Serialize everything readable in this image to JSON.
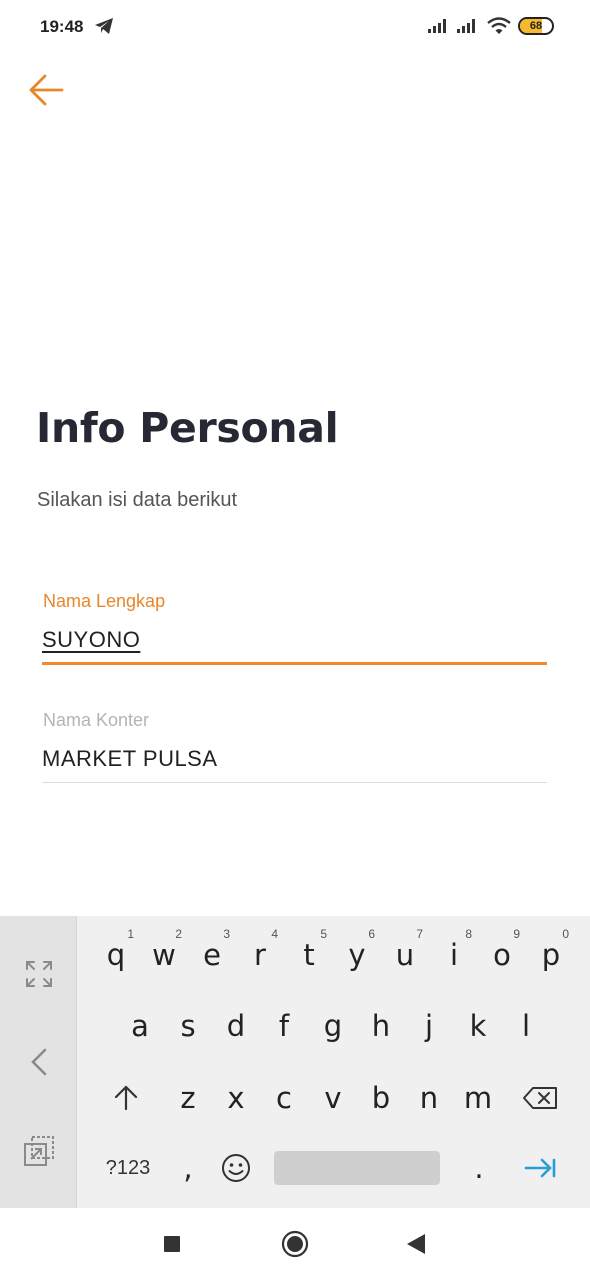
{
  "status_bar": {
    "time": "19:48",
    "battery_level": "68",
    "battery_fraction": 0.68,
    "icons": [
      "telegram-icon",
      "signal-icon",
      "signal-icon",
      "wifi-icon",
      "battery-icon"
    ]
  },
  "header": {
    "back_icon": "arrow-left-icon"
  },
  "page": {
    "title": "Info Personal",
    "subtitle": "Silakan isi data berikut"
  },
  "form": {
    "name_label": "Nama Lengkap",
    "name_value": "SUYONO",
    "store_label": "Nama Konter",
    "store_value": "MARKET PULSA"
  },
  "keyboard": {
    "row1": [
      {
        "key": "q",
        "hint": "1"
      },
      {
        "key": "w",
        "hint": "2"
      },
      {
        "key": "e",
        "hint": "3"
      },
      {
        "key": "r",
        "hint": "4"
      },
      {
        "key": "t",
        "hint": "5"
      },
      {
        "key": "y",
        "hint": "6"
      },
      {
        "key": "u",
        "hint": "7"
      },
      {
        "key": "i",
        "hint": "8"
      },
      {
        "key": "o",
        "hint": "9"
      },
      {
        "key": "p",
        "hint": "0"
      }
    ],
    "row2": [
      "a",
      "s",
      "d",
      "f",
      "g",
      "h",
      "j",
      "k",
      "l"
    ],
    "row3": [
      "z",
      "x",
      "c",
      "v",
      "b",
      "n",
      "m"
    ],
    "symbols_label": "?123",
    "comma": ",",
    "period": ".",
    "icons": [
      "expand-icon",
      "chevron-left-icon",
      "clipboard-icon",
      "shift-icon",
      "backspace-icon",
      "emoji-icon",
      "enter-tab-icon"
    ]
  },
  "colors": {
    "accent": "#ef8a2f",
    "title": "#262833",
    "enter_key": "#2a9bd6"
  }
}
